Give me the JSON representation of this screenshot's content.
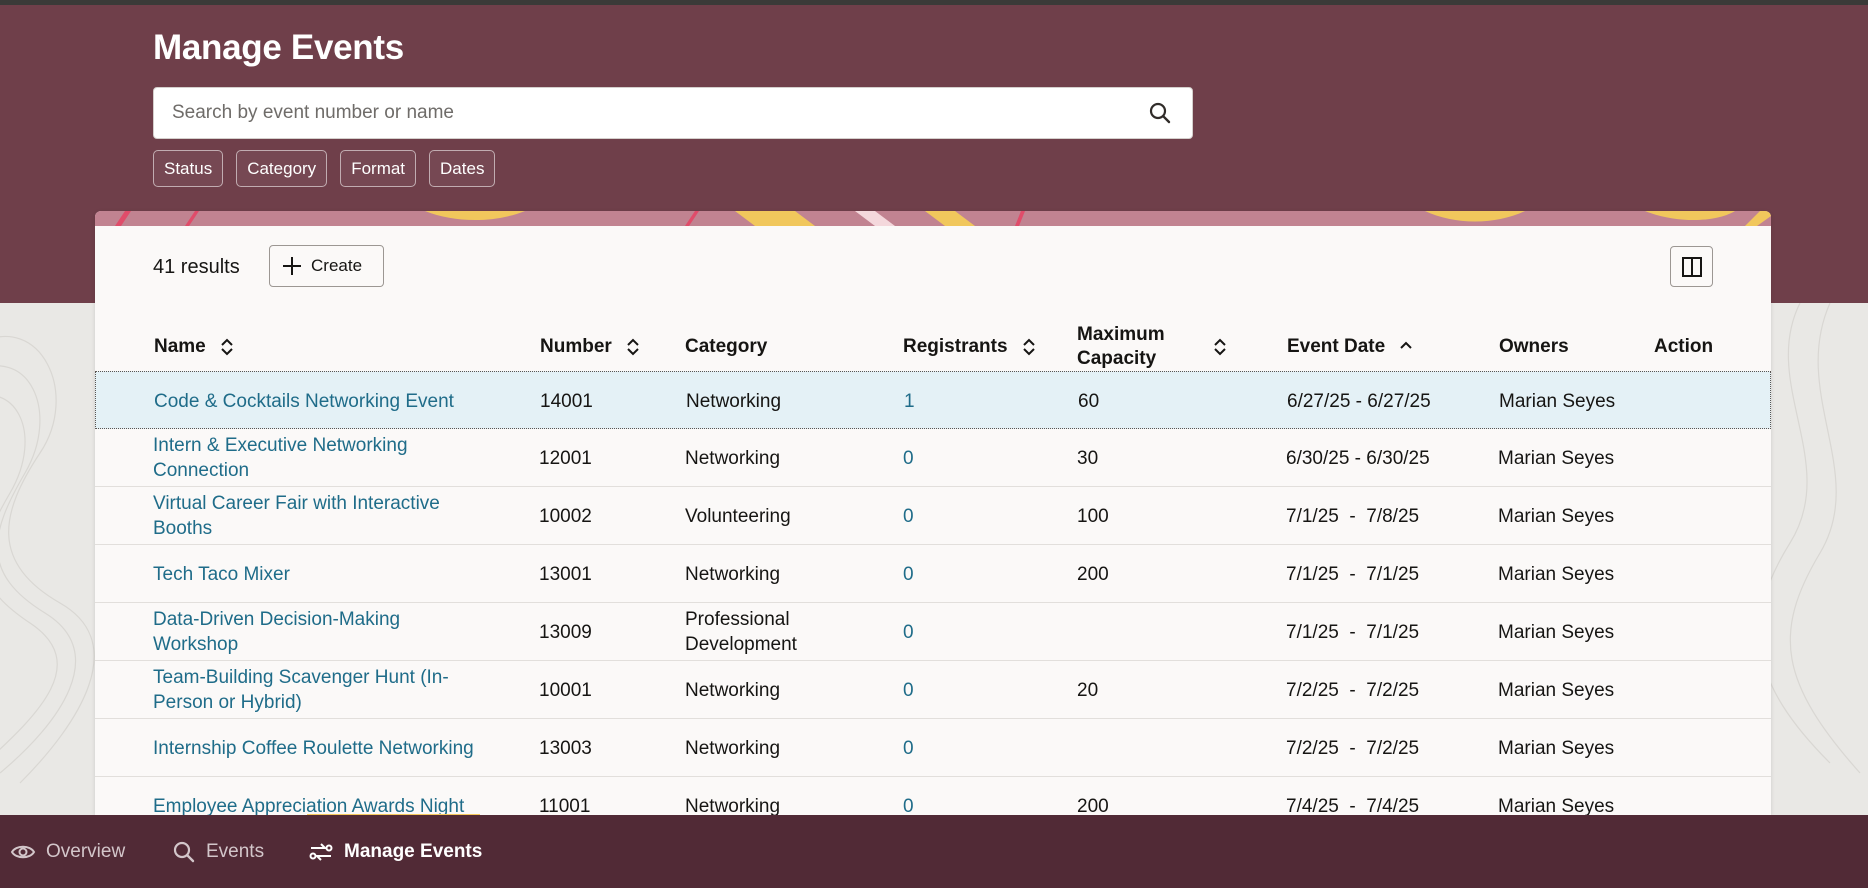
{
  "page": {
    "title": "Manage Events"
  },
  "search": {
    "placeholder": "Search by event number or name"
  },
  "filters": [
    "Status",
    "Category",
    "Format",
    "Dates"
  ],
  "toolbar": {
    "results_count": "41 results",
    "create_label": "Create"
  },
  "table": {
    "columns": {
      "name": "Name",
      "number": "Number",
      "category": "Category",
      "registrants": "Registrants",
      "max_capacity_line1": "Maximum",
      "max_capacity_line2": "Capacity",
      "event_date": "Event Date",
      "owners": "Owners",
      "action": "Action"
    },
    "rows": [
      {
        "name": "Code & Cocktails Networking Event",
        "number": "14001",
        "category": "Networking",
        "registrants": "1",
        "capacity": "60",
        "date": "6/27/25 - 6/27/25",
        "owners": "Marian Seyes"
      },
      {
        "name": "Intern & Executive Networking Connection",
        "number": "12001",
        "category": "Networking",
        "registrants": "0",
        "capacity": "30",
        "date": "6/30/25 - 6/30/25",
        "owners": "Marian Seyes"
      },
      {
        "name": "Virtual Career Fair with Interactive Booths",
        "number": "10002",
        "category": "Volunteering",
        "registrants": "0",
        "capacity": "100",
        "date": "7/1/25  -  7/8/25",
        "owners": "Marian Seyes"
      },
      {
        "name": "Tech Taco Mixer",
        "number": "13001",
        "category": "Networking",
        "registrants": "0",
        "capacity": "200",
        "date": "7/1/25  -  7/1/25",
        "owners": "Marian Seyes"
      },
      {
        "name": "Data-Driven Decision-Making Workshop",
        "number": "13009",
        "category": "Professional Development",
        "registrants": "0",
        "capacity": "",
        "date": "7/1/25  -  7/1/25",
        "owners": "Marian Seyes"
      },
      {
        "name": "Team-Building Scavenger Hunt (In-Person or Hybrid)",
        "number": "10001",
        "category": "Networking",
        "registrants": "0",
        "capacity": "20",
        "date": "7/2/25  -  7/2/25",
        "owners": "Marian Seyes"
      },
      {
        "name": "Internship Coffee Roulette Networking",
        "number": "13003",
        "category": "Networking",
        "registrants": "0",
        "capacity": "",
        "date": "7/2/25  -  7/2/25",
        "owners": "Marian Seyes"
      },
      {
        "name": "Employee Appreciation Awards Night",
        "number": "11001",
        "category": "Networking",
        "registrants": "0",
        "capacity": "200",
        "date": "7/4/25  -  7/4/25",
        "owners": "Marian Seyes"
      }
    ]
  },
  "nav": {
    "items": [
      {
        "label": "Overview",
        "icon": "eye-icon"
      },
      {
        "label": "Events",
        "icon": "search-icon"
      },
      {
        "label": "Manage Events",
        "icon": "manage-events-icon"
      }
    ],
    "active": "Manage Events"
  },
  "colors": {
    "hero": "#6f3f4a",
    "navbar": "#512a36",
    "link": "#1f6c89",
    "selected_row": "#e4f1f6",
    "active_underline": "#f5c85c"
  }
}
